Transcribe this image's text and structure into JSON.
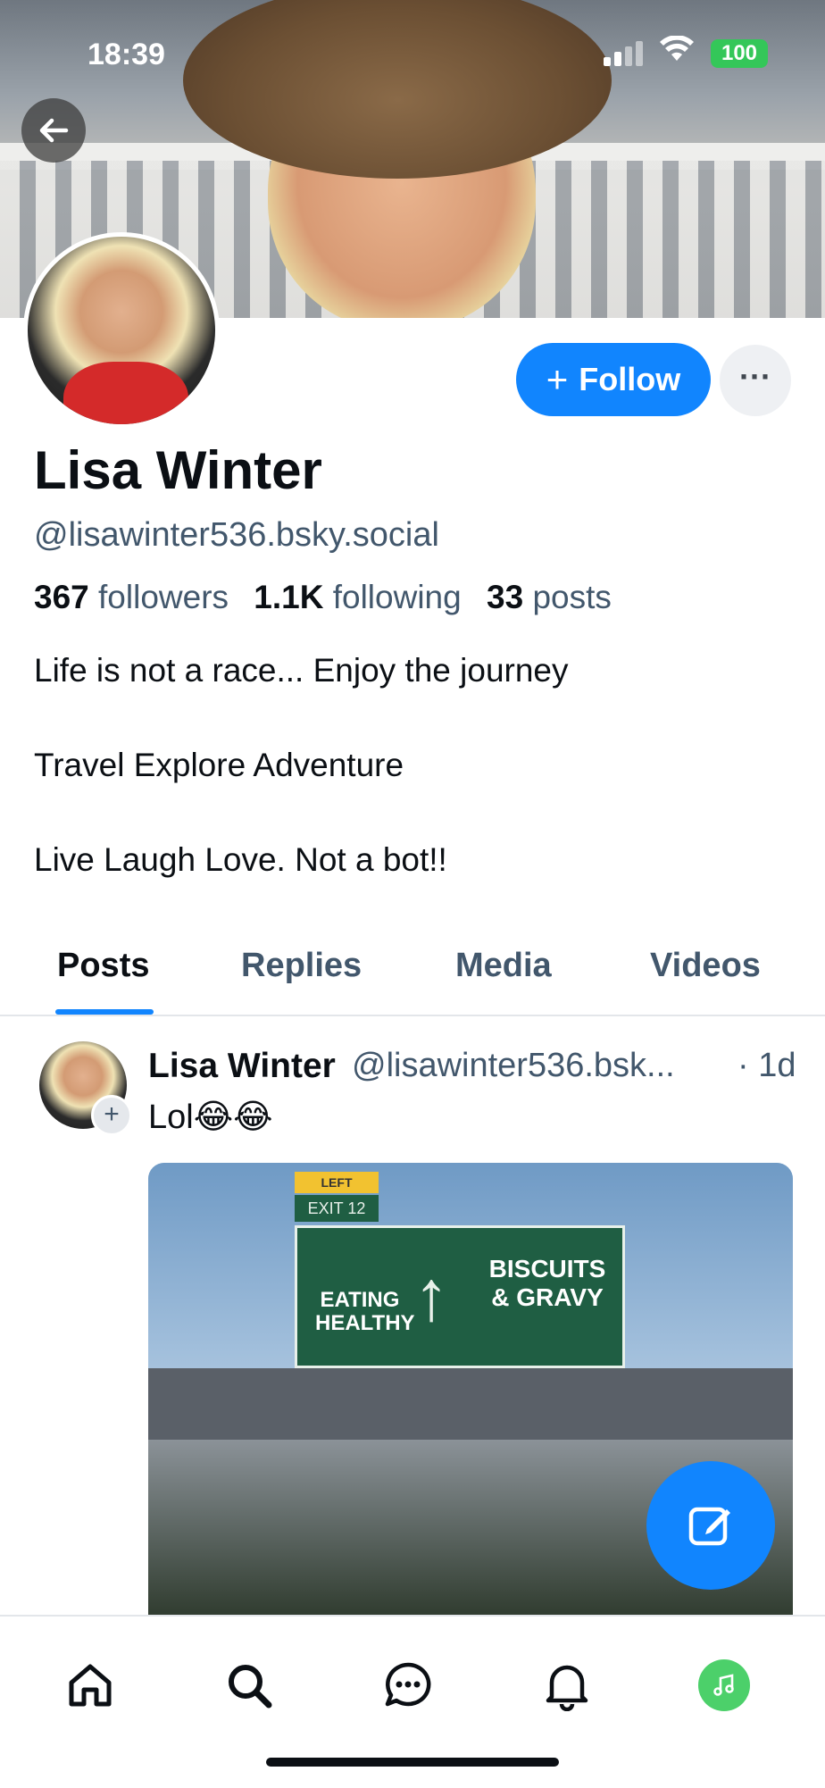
{
  "status_bar": {
    "time": "18:39",
    "battery": "100"
  },
  "profile": {
    "name": "Lisa Winter",
    "handle": "@lisawinter536.bsky.social",
    "follow_label": "Follow",
    "more_label": "···",
    "stats": {
      "followers_count": "367",
      "followers_label": "followers",
      "following_count": "1.1K",
      "following_label": "following",
      "posts_count": "33",
      "posts_label": "posts"
    },
    "bio": [
      "Life is not a race... Enjoy the journey",
      "Travel Explore Adventure",
      "Live Laugh Love. Not a bot!!"
    ]
  },
  "tabs": [
    {
      "label": "Posts",
      "active": true
    },
    {
      "label": "Replies",
      "active": false
    },
    {
      "label": "Media",
      "active": false
    },
    {
      "label": "Videos",
      "active": false
    }
  ],
  "post": {
    "author": "Lisa Winter",
    "handle": "@lisawinter536.bsk...",
    "time": "· 1d",
    "text": "Lol😂😂",
    "image": {
      "exit_tag": "LEFT",
      "exit_number": "EXIT 12",
      "left_text": "EATING HEALTHY",
      "right_text": "BISCUITS & GRAVY"
    }
  },
  "colors": {
    "accent": "#1185fe",
    "muted": "#42576c",
    "music": "#4cd06a"
  },
  "icons": [
    "back-arrow-icon",
    "home-icon",
    "search-icon",
    "chat-icon",
    "bell-icon",
    "music-icon",
    "compose-icon"
  ]
}
